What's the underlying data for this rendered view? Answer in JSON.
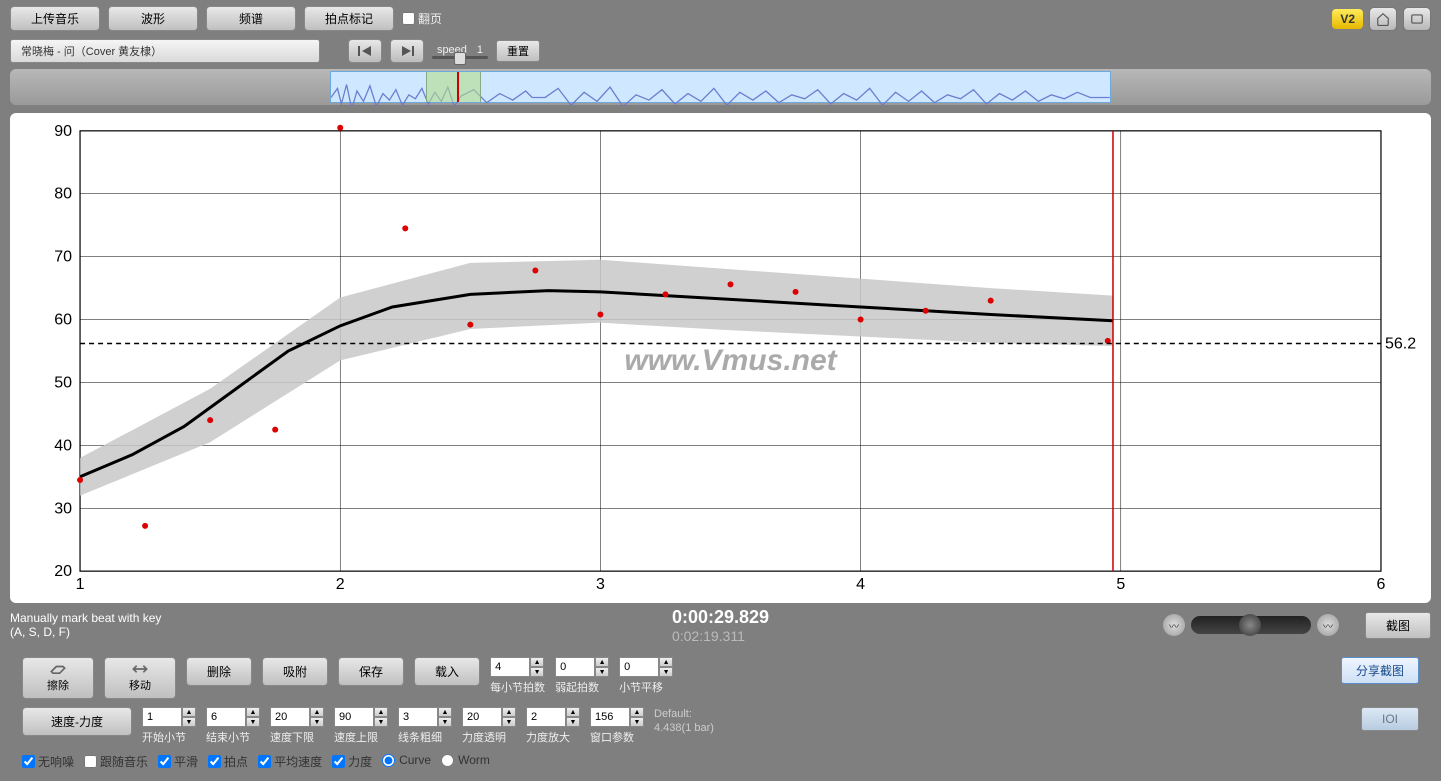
{
  "toolbar": {
    "upload": "上传音乐",
    "waveform": "波形",
    "spectrum": "频谱",
    "beat_mark": "拍点标记",
    "flip_page": "翻页",
    "version": "V2"
  },
  "track": {
    "title": "常晓梅 - 问（Cover 黄友棣）",
    "speed_label": "speed",
    "speed_value": "1",
    "reset": "重置"
  },
  "chart_data": {
    "type": "line",
    "title": "",
    "watermark": "www.Vmus.net",
    "xlabel": "",
    "ylabel": "",
    "xlim": [
      1,
      6
    ],
    "ylim": [
      20,
      90
    ],
    "x_ticks": [
      1,
      2,
      3,
      4,
      5,
      6
    ],
    "y_ticks": [
      20,
      30,
      40,
      50,
      60,
      70,
      80,
      90
    ],
    "reference_line": 56.2,
    "cursor_x": 4.97,
    "scatter": [
      {
        "x": 1.0,
        "y": 34.5
      },
      {
        "x": 1.25,
        "y": 27.2
      },
      {
        "x": 1.5,
        "y": 44.0
      },
      {
        "x": 1.75,
        "y": 42.5
      },
      {
        "x": 2.0,
        "y": 90.5
      },
      {
        "x": 2.25,
        "y": 74.5
      },
      {
        "x": 2.5,
        "y": 59.2
      },
      {
        "x": 2.75,
        "y": 67.8
      },
      {
        "x": 3.0,
        "y": 60.8
      },
      {
        "x": 3.25,
        "y": 64.0
      },
      {
        "x": 3.5,
        "y": 65.6
      },
      {
        "x": 3.75,
        "y": 64.4
      },
      {
        "x": 4.0,
        "y": 60.0
      },
      {
        "x": 4.25,
        "y": 61.4
      },
      {
        "x": 4.5,
        "y": 63.0
      },
      {
        "x": 4.95,
        "y": 56.6
      }
    ],
    "curve": [
      {
        "x": 1.0,
        "y": 35.0
      },
      {
        "x": 1.2,
        "y": 38.5
      },
      {
        "x": 1.4,
        "y": 43.0
      },
      {
        "x": 1.6,
        "y": 49.0
      },
      {
        "x": 1.8,
        "y": 55.0
      },
      {
        "x": 2.0,
        "y": 59.0
      },
      {
        "x": 2.2,
        "y": 62.0
      },
      {
        "x": 2.5,
        "y": 64.0
      },
      {
        "x": 2.8,
        "y": 64.6
      },
      {
        "x": 3.0,
        "y": 64.4
      },
      {
        "x": 3.5,
        "y": 63.2
      },
      {
        "x": 4.0,
        "y": 62.0
      },
      {
        "x": 4.5,
        "y": 60.8
      },
      {
        "x": 4.97,
        "y": 59.8
      }
    ],
    "band_upper": [
      {
        "x": 1.0,
        "y": 38.0
      },
      {
        "x": 1.5,
        "y": 49.0
      },
      {
        "x": 2.0,
        "y": 63.5
      },
      {
        "x": 2.5,
        "y": 69.0
      },
      {
        "x": 3.0,
        "y": 69.5
      },
      {
        "x": 3.5,
        "y": 68.0
      },
      {
        "x": 4.0,
        "y": 66.5
      },
      {
        "x": 4.5,
        "y": 65.0
      },
      {
        "x": 4.97,
        "y": 63.8
      }
    ],
    "band_lower": [
      {
        "x": 1.0,
        "y": 32.0
      },
      {
        "x": 1.5,
        "y": 40.5
      },
      {
        "x": 2.0,
        "y": 53.5
      },
      {
        "x": 2.5,
        "y": 58.5
      },
      {
        "x": 3.0,
        "y": 59.5
      },
      {
        "x": 3.5,
        "y": 58.3
      },
      {
        "x": 4.0,
        "y": 57.3
      },
      {
        "x": 4.5,
        "y": 56.3
      },
      {
        "x": 4.97,
        "y": 55.8
      }
    ]
  },
  "status": {
    "hint1": "Manually mark beat with key",
    "hint2": "(A, S, D, F)",
    "time_current": "0:00:29.829",
    "time_total": "0:02:19.311",
    "screenshot": "截图"
  },
  "tools": {
    "erase": "擦除",
    "move": "移动",
    "delete": "删除",
    "snap": "吸附",
    "save": "保存",
    "import": "载入",
    "beats_per_bar_label": "每小节拍数",
    "beats_per_bar": "4",
    "anacrusis_label": "弱起拍数",
    "anacrusis": "0",
    "bar_offset_label": "小节平移",
    "bar_offset": "0",
    "share": "分享截图"
  },
  "params": {
    "tempo_dynamics": "速度-力度",
    "start_bar_label": "开始小节",
    "start_bar": "1",
    "end_bar_label": "结束小节",
    "end_bar": "6",
    "tempo_min_label": "速度下限",
    "tempo_min": "20",
    "tempo_max_label": "速度上限",
    "tempo_max": "90",
    "line_thick_label": "线条粗细",
    "line_thick": "3",
    "dyn_trans_label": "力度透明",
    "dyn_trans": "20",
    "dyn_scale_label": "力度放大",
    "dyn_scale": "2",
    "window_label": "窗口参数",
    "window": "156",
    "default_label": "Default:",
    "default_value": "4.438(1 bar)",
    "ioi": "IOI"
  },
  "checks": {
    "no_noise": "无响噪",
    "follow_music": "跟随音乐",
    "smooth": "平滑",
    "beat": "拍点",
    "avg_tempo": "平均速度",
    "dynamics": "力度",
    "curve": "Curve",
    "worm": "Worm"
  }
}
